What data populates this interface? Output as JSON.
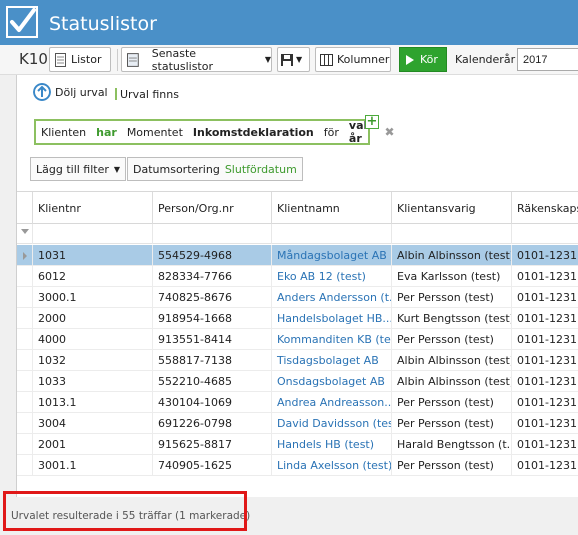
{
  "app": {
    "title": "Statuslistor",
    "module": "K10"
  },
  "toolbar": {
    "listor_label": "Listor",
    "saved_list_label": "Senaste statuslistor",
    "columns_label": "Kolumner",
    "run_label": "Kör",
    "year_label": "Kalenderår",
    "year_value": "2017"
  },
  "filter": {
    "hide_label": "Dölj urval",
    "exists_label": "Urval finns",
    "expression": {
      "w1": "Klienten",
      "w2": "har",
      "w3": "Momentet",
      "w4": "Inkomstdeklaration",
      "w5": "för",
      "w6": "valt år"
    },
    "add_filter_label": "Lägg till filter",
    "date_sort_label": "Datumsortering",
    "date_sort_value": "Slutfördatum"
  },
  "grid": {
    "columns": [
      "Klientnr",
      "Person/Org.nr",
      "Klientnamn",
      "Klientansvarig",
      "Räkenskaps"
    ],
    "rows": [
      [
        "1031",
        "554529-4968",
        "Måndagsbolaget AB",
        "Albin Albinsson (test)",
        "0101-1231"
      ],
      [
        "6012",
        "828334-7766",
        "Eko AB 12 (test)",
        "Eva Karlsson (test)",
        "0101-1231"
      ],
      [
        "3000.1",
        "740825-8676",
        "Anders Andersson (t...",
        "Per  Persson (test)",
        "0101-1231"
      ],
      [
        "2000",
        "918954-1668",
        "Handelsbolaget HB...",
        "Kurt Bengtsson (test)",
        "0101-1231"
      ],
      [
        "4000",
        "913551-8414",
        "Kommanditen KB (test)",
        "Per  Persson (test)",
        "0101-1231"
      ],
      [
        "1032",
        "558817-7138",
        "Tisdagsbolaget AB",
        "Albin Albinsson (test)",
        "0101-1231"
      ],
      [
        "1033",
        "552210-4685",
        "Onsdagsbolaget AB",
        "Albin Albinsson (test)",
        "0101-1231"
      ],
      [
        "1013.1",
        "430104-1069",
        "Andrea Andreasson...",
        "Per  Persson (test)",
        "0101-1231"
      ],
      [
        "3004",
        "691226-0798",
        "David Davidsson (test)",
        "Per  Persson (test)",
        "0101-1231"
      ],
      [
        "2001",
        "915625-8817",
        "Handels HB (test)",
        "Harald Bengtsson (t...",
        "0101-1231"
      ],
      [
        "3001.1",
        "740905-1625",
        "Linda Axelsson (test)",
        "Per  Persson (test)",
        "0101-1231"
      ]
    ],
    "selected_index": 0
  },
  "status": {
    "text": "Urvalet resulterade i 55 träffar (1 markerade)"
  },
  "colors": {
    "titlebar": "#4a90c8",
    "run": "#2ea32e",
    "link": "#2a73b5",
    "selected": "#a9cbe6",
    "highlight": "#e01818",
    "filter_border": "#8cc060"
  }
}
